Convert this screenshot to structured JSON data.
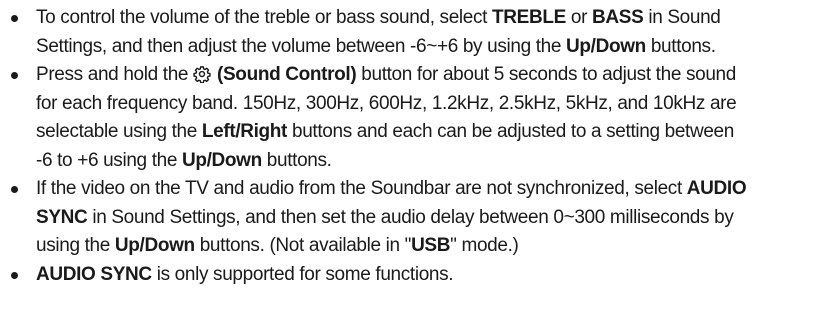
{
  "items": [
    {
      "lines": [
        [
          {
            "t": "To control the volume of the treble or bass sound, select "
          },
          {
            "t": "TREBLE",
            "b": true
          },
          {
            "t": " or "
          },
          {
            "t": "BASS",
            "b": true
          },
          {
            "t": " in Sound"
          }
        ],
        [
          {
            "t": "Settings, and then adjust the volume between -6~+6 by using the "
          },
          {
            "t": "Up/Down",
            "b": true
          },
          {
            "t": " buttons."
          }
        ]
      ]
    },
    {
      "lines": [
        [
          {
            "t": "Press and hold the "
          },
          {
            "icon": "sound-control-gear-icon"
          },
          {
            "t": " (Sound Control)",
            "b": true
          },
          {
            "t": " button for about 5 seconds to adjust the sound"
          }
        ],
        [
          {
            "t": "for each frequency band. 150Hz, 300Hz, 600Hz, 1.2kHz, 2.5kHz, 5kHz, and 10kHz are"
          }
        ],
        [
          {
            "t": "selectable using the "
          },
          {
            "t": "Left/Right",
            "b": true
          },
          {
            "t": " buttons and each can be adjusted to a setting between"
          }
        ],
        [
          {
            "t": "-6 to +6 using the "
          },
          {
            "t": "Up/Down",
            "b": true
          },
          {
            "t": " buttons."
          }
        ]
      ]
    },
    {
      "lines": [
        [
          {
            "t": "If the video on the TV and audio from the Soundbar are not synchronized, select "
          },
          {
            "t": "AUDIO",
            "b": true
          }
        ],
        [
          {
            "t": "SYNC",
            "b": true
          },
          {
            "t": " in Sound Settings, and then set the audio delay between 0~300 milliseconds by"
          }
        ],
        [
          {
            "t": "using the "
          },
          {
            "t": "Up/Down",
            "b": true
          },
          {
            "t": " buttons. (Not available in \""
          },
          {
            "t": "USB",
            "b": true
          },
          {
            "t": "\" mode.)"
          }
        ]
      ]
    },
    {
      "lines": [
        [
          {
            "t": "AUDIO SYNC",
            "b": true
          },
          {
            "t": " is only supported for some functions."
          }
        ]
      ]
    }
  ]
}
